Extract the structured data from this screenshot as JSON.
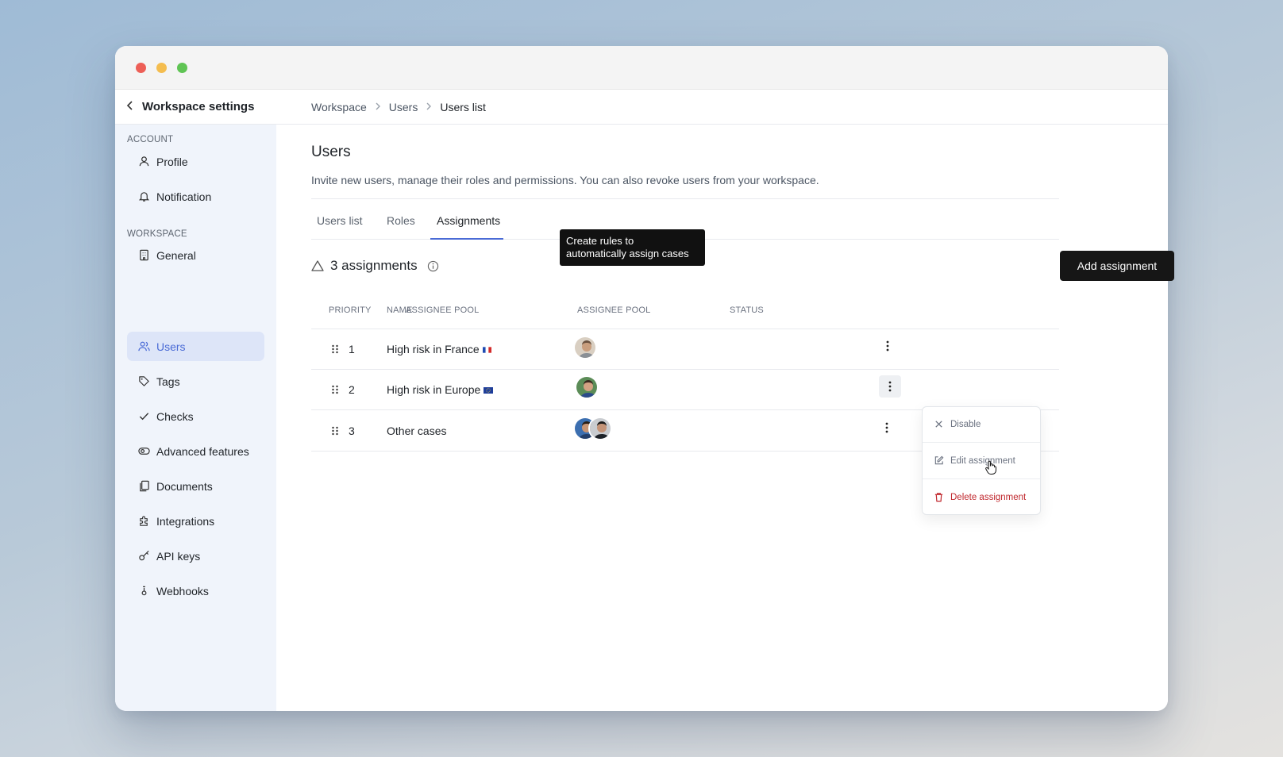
{
  "sidebar": {
    "back_label": "Workspace settings",
    "sections": [
      {
        "label": "ACCOUNT",
        "items": [
          {
            "label": "Profile",
            "icon": "user-icon"
          },
          {
            "label": "Notification",
            "icon": "bell-icon"
          }
        ]
      },
      {
        "label": "WORKSPACE",
        "items": [
          {
            "label": "General",
            "icon": "building-icon"
          },
          {
            "label": "Users",
            "icon": "users-icon",
            "active": true
          },
          {
            "label": "Tags",
            "icon": "tag-icon"
          },
          {
            "label": "Checks",
            "icon": "check-icon"
          },
          {
            "label": "Advanced features",
            "icon": "toggle-icon"
          },
          {
            "label": "Documents",
            "icon": "documents-icon"
          },
          {
            "label": "Integrations",
            "icon": "puzzle-icon"
          },
          {
            "label": "API keys",
            "icon": "key-icon"
          },
          {
            "label": "Webhooks",
            "icon": "webhook-icon"
          }
        ]
      }
    ]
  },
  "breadcrumb": [
    "Workspace",
    "Users",
    "Users list"
  ],
  "page": {
    "title": "Users",
    "description": "Invite new users, manage their roles and permissions. You can also revoke users from your workspace."
  },
  "tabs": [
    {
      "label": "Users list"
    },
    {
      "label": "Roles"
    },
    {
      "label": "Assignments",
      "active": true
    }
  ],
  "tooltip": {
    "line1": "Create rules to",
    "line2": "automatically assign cases"
  },
  "assignments": {
    "count_label": "3 assignments",
    "add_button": "Add assignment",
    "columns": {
      "priority": "PRIORITY",
      "name": "NAME",
      "name_overlap": "ASSIGNEE POOL",
      "assignee_pool": "ASSIGNEE POOL",
      "status": "STATUS"
    },
    "rows": [
      {
        "priority": "1",
        "name": "High risk in France",
        "flag": "france-flag"
      },
      {
        "priority": "2",
        "name": "High risk in Europe",
        "flag": "eu-flag"
      },
      {
        "priority": "3",
        "name": "Other cases",
        "flag": ""
      }
    ]
  },
  "context_menu": {
    "items": [
      {
        "label": "Disable",
        "icon": "close-icon"
      },
      {
        "label": "Edit assignment",
        "icon": "edit-icon"
      },
      {
        "label": "Delete assignment",
        "icon": "trash-icon",
        "color": "#c0272d"
      }
    ]
  },
  "colors": {
    "accent": "#4a6bd6",
    "danger": "#c0272d",
    "sidebar_bg": "#f0f4fb"
  }
}
